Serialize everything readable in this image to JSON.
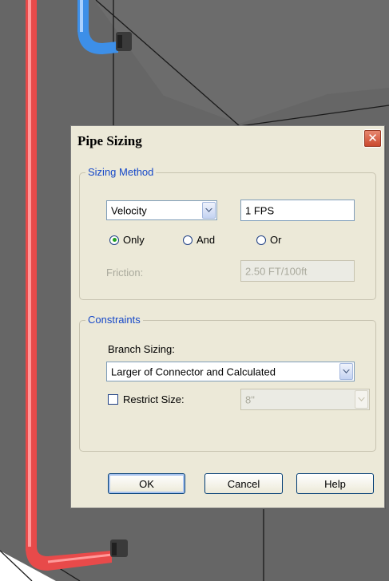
{
  "dialog": {
    "title": "Pipe Sizing",
    "close_icon": "✕"
  },
  "sizing_method": {
    "legend": "Sizing Method",
    "method_selected": "Velocity",
    "velocity_value": "1 FPS",
    "radios": [
      {
        "label": "Only",
        "checked": true
      },
      {
        "label": "And",
        "checked": false
      },
      {
        "label": "Or",
        "checked": false
      }
    ],
    "friction_label": "Friction:",
    "friction_value": "2.50 FT/100ft"
  },
  "constraints": {
    "legend": "Constraints",
    "branch_label": "Branch Sizing:",
    "branch_selected": "Larger of Connector and Calculated",
    "restrict_label": "Restrict Size:",
    "restrict_checked": false,
    "restrict_value": "8\""
  },
  "buttons": {
    "ok": "OK",
    "cancel": "Cancel",
    "help": "Help"
  },
  "colors": {
    "pipe_red": "#e84a4a",
    "pipe_blue": "#3d8fe8",
    "scene_gray": "#666666",
    "legend_blue": "#1447c8",
    "dialog_bg": "#ece9d8"
  },
  "icons": [
    "close-icon",
    "chevron-down-icon",
    "radio-icon",
    "checkbox-icon"
  ]
}
